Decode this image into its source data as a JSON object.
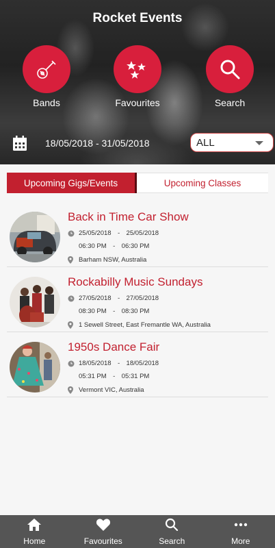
{
  "app_title": "Rocket Events",
  "hero_buttons": [
    {
      "label": "Bands",
      "icon": "guitar-icon"
    },
    {
      "label": "Favourites",
      "icon": "stars-icon"
    },
    {
      "label": "Search",
      "icon": "search-icon"
    }
  ],
  "date_range": "18/05/2018 - 31/05/2018",
  "filter": {
    "selected": "ALL"
  },
  "tabs": {
    "active": "Upcoming Gigs/Events",
    "inactive": "Upcoming Classes"
  },
  "events": [
    {
      "title": "Back in Time Car Show",
      "start_date": "25/05/2018",
      "end_date": "25/05/2018",
      "start_time": "06:30 PM",
      "end_time": "06:30 PM",
      "location": "Barham NSW, Australia"
    },
    {
      "title": "Rockabilly Music Sundays",
      "start_date": "27/05/2018",
      "end_date": "27/05/2018",
      "start_time": "08:30 PM",
      "end_time": "08:30 PM",
      "location": "1 Sewell Street, East Fremantle WA, Australia"
    },
    {
      "title": "1950s Dance Fair",
      "start_date": "18/05/2018",
      "end_date": "18/05/2018",
      "start_time": "05:31 PM",
      "end_time": "05:31 PM",
      "location": "Vermont VIC, Australia"
    }
  ],
  "date_separator": "-",
  "bottom_nav": [
    {
      "label": "Home",
      "icon": "home-icon"
    },
    {
      "label": "Favourites",
      "icon": "heart-icon"
    },
    {
      "label": "Search",
      "icon": "search-icon"
    },
    {
      "label": "More",
      "icon": "more-icon"
    }
  ],
  "colors": {
    "accent": "#d81f3c",
    "tab_active": "#c2202f",
    "nav_bg": "#555555"
  }
}
